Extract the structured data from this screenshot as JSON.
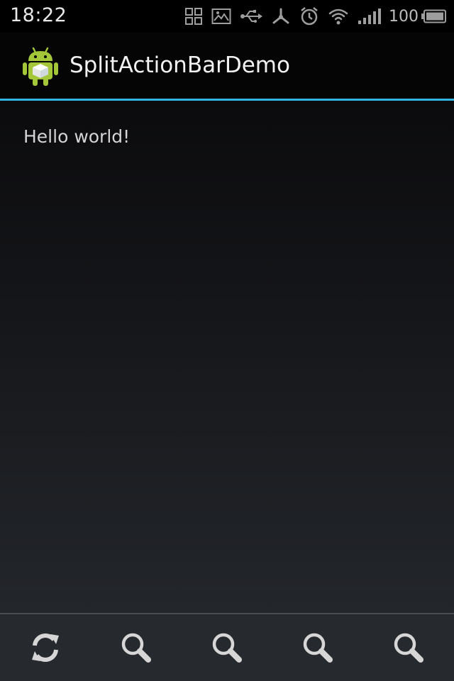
{
  "status_bar": {
    "time": "18:22",
    "battery_level": "100",
    "icons": [
      "grid-icon",
      "image-icon",
      "usb-icon",
      "debug-icon",
      "alarm-icon",
      "wifi-icon",
      "signal-icon",
      "battery-icon"
    ]
  },
  "action_bar": {
    "app_icon": "android-icon",
    "title": "SplitActionBarDemo"
  },
  "content": {
    "text": "Hello world!"
  },
  "split_action_bar": {
    "items": [
      {
        "icon": "refresh-icon"
      },
      {
        "icon": "search-icon"
      },
      {
        "icon": "search-icon"
      },
      {
        "icon": "search-icon"
      },
      {
        "icon": "search-icon"
      }
    ]
  },
  "colors": {
    "accent": "#33b5e5",
    "android_green": "#a4c639"
  }
}
